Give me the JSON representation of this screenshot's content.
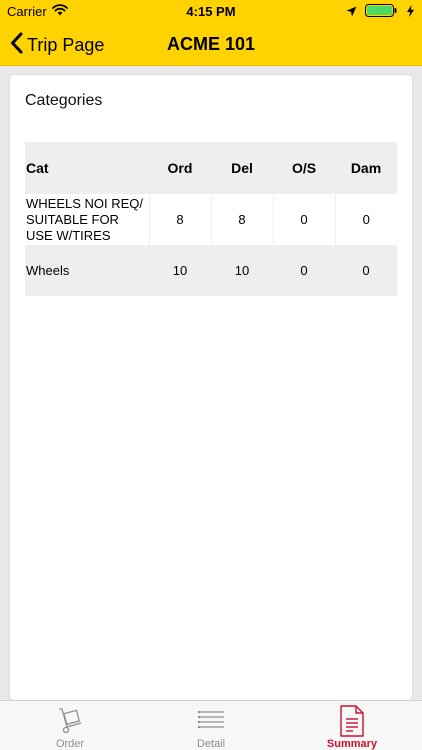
{
  "status_bar": {
    "carrier": "Carrier",
    "time": "4:15 PM"
  },
  "nav": {
    "back_label": "Trip Page",
    "title": "ACME 101"
  },
  "card": {
    "title": "Categories",
    "table": {
      "headers": [
        "Cat",
        "Ord",
        "Del",
        "O/S",
        "Dam"
      ],
      "rows": [
        {
          "cat": "WHEELS NOI REQ/ SUITABLE FOR USE W/TIRES",
          "ord": "8",
          "del": "8",
          "os": "0",
          "dam": "0"
        },
        {
          "cat": "Wheels",
          "ord": "10",
          "del": "10",
          "os": "0",
          "dam": "0"
        }
      ]
    }
  },
  "tabs": [
    {
      "label": "Order",
      "icon": "hand-truck-icon"
    },
    {
      "label": "Detail",
      "icon": "list-icon"
    },
    {
      "label": "Summary",
      "icon": "document-icon"
    }
  ],
  "colors": {
    "header": "#ffd200",
    "accent": "#c8102e",
    "table_shade": "#eeeeee"
  }
}
